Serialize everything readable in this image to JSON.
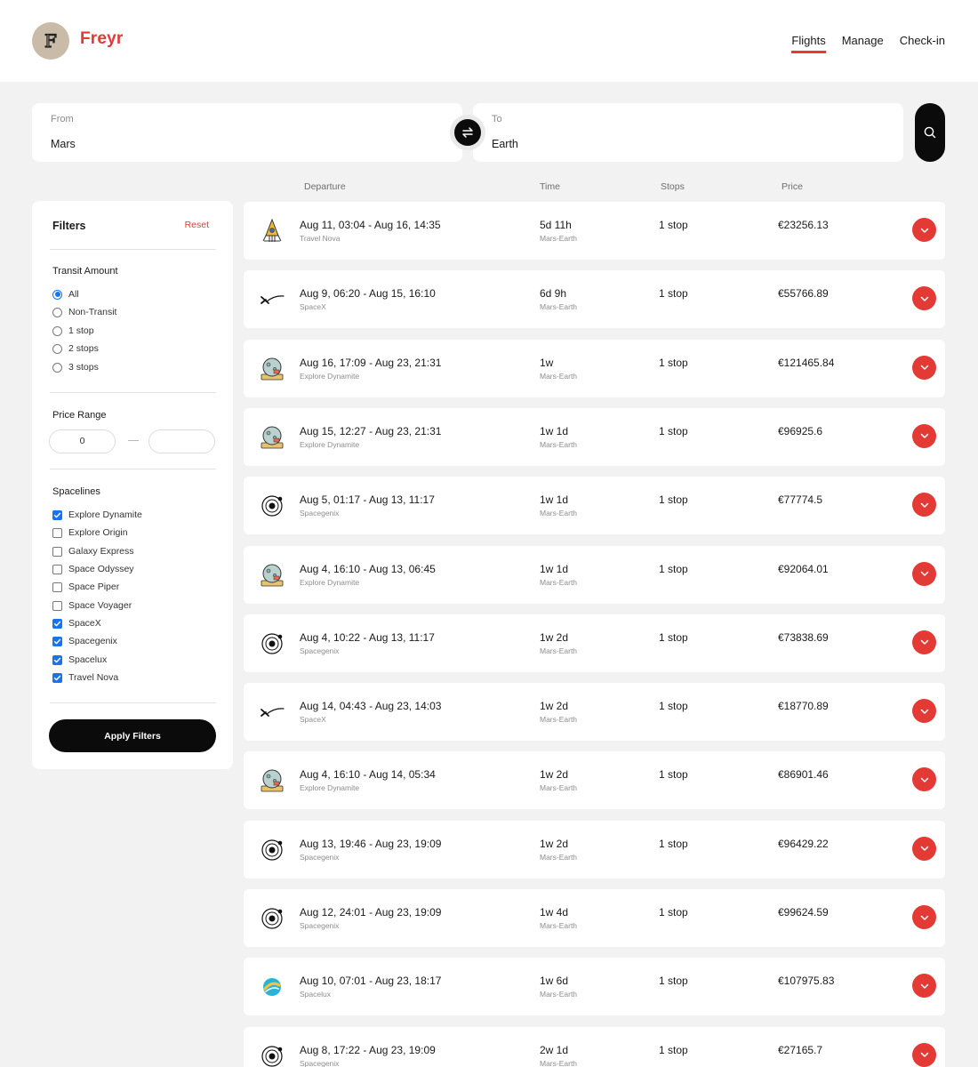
{
  "header": {
    "logo_letter": "F",
    "brand": "Freyr",
    "nav": [
      {
        "label": "Flights",
        "active": true
      },
      {
        "label": "Manage",
        "active": false
      },
      {
        "label": "Check-in",
        "active": false
      }
    ]
  },
  "search": {
    "from_label": "From",
    "from_value": "Mars",
    "to_label": "To",
    "to_value": "Earth",
    "swap_icon": "swap-arrows-icon",
    "search_icon": "search-icon"
  },
  "columns": {
    "departure": "Departure",
    "time": "Time",
    "stops": "Stops",
    "price": "Price"
  },
  "filters": {
    "title": "Filters",
    "reset": "Reset",
    "transit_title": "Transit Amount",
    "transit_options": [
      {
        "label": "All",
        "selected": true
      },
      {
        "label": "Non-Transit",
        "selected": false
      },
      {
        "label": "1 stop",
        "selected": false
      },
      {
        "label": "2 stops",
        "selected": false
      },
      {
        "label": "3 stops",
        "selected": false
      }
    ],
    "price_title": "Price Range",
    "price_min": "0",
    "price_max": "",
    "spacelines_title": "Spacelines",
    "spacelines": [
      {
        "label": "Explore Dynamite",
        "checked": true
      },
      {
        "label": "Explore Origin",
        "checked": false
      },
      {
        "label": "Galaxy Express",
        "checked": false
      },
      {
        "label": "Space Odyssey",
        "checked": false
      },
      {
        "label": "Space Piper",
        "checked": false
      },
      {
        "label": "Space Voyager",
        "checked": false
      },
      {
        "label": "SpaceX",
        "checked": true
      },
      {
        "label": "Spacegenix",
        "checked": true
      },
      {
        "label": "Spacelux",
        "checked": true
      },
      {
        "label": "Travel Nova",
        "checked": true
      }
    ],
    "apply": "Apply Filters"
  },
  "flights": [
    {
      "departure": "Aug 11, 03:04 - Aug 16, 14:35",
      "airline": "Travel Nova",
      "logo": "rocket-logo",
      "time": "5d 11h",
      "route": "Mars-Earth",
      "stops": "1 stop",
      "price": "€23256.13"
    },
    {
      "departure": "Aug 9, 06:20 - Aug 15, 16:10",
      "airline": "SpaceX",
      "logo": "spacex-logo",
      "time": "6d 9h",
      "route": "Mars-Earth",
      "stops": "1 stop",
      "price": "€55766.89"
    },
    {
      "departure": "Aug 16, 17:09 - Aug 23, 21:31",
      "airline": "Explore Dynamite",
      "logo": "moon-logo",
      "time": "1w",
      "route": "Mars-Earth",
      "stops": "1 stop",
      "price": "€121465.84"
    },
    {
      "departure": "Aug 15, 12:27 - Aug 23, 21:31",
      "airline": "Explore Dynamite",
      "logo": "moon-logo",
      "time": "1w 1d",
      "route": "Mars-Earth",
      "stops": "1 stop",
      "price": "€96925.6"
    },
    {
      "departure": "Aug 5, 01:17 - Aug 13, 11:17",
      "airline": "Spacegenix",
      "logo": "orbit-logo",
      "time": "1w 1d",
      "route": "Mars-Earth",
      "stops": "1 stop",
      "price": "€77774.5"
    },
    {
      "departure": "Aug 4, 16:10 - Aug 13, 06:45",
      "airline": "Explore Dynamite",
      "logo": "moon-logo",
      "time": "1w 1d",
      "route": "Mars-Earth",
      "stops": "1 stop",
      "price": "€92064.01"
    },
    {
      "departure": "Aug 4, 10:22 - Aug 13, 11:17",
      "airline": "Spacegenix",
      "logo": "orbit-logo",
      "time": "1w 2d",
      "route": "Mars-Earth",
      "stops": "1 stop",
      "price": "€73838.69"
    },
    {
      "departure": "Aug 14, 04:43 - Aug 23, 14:03",
      "airline": "SpaceX",
      "logo": "spacex-logo",
      "time": "1w 2d",
      "route": "Mars-Earth",
      "stops": "1 stop",
      "price": "€18770.89"
    },
    {
      "departure": "Aug 4, 16:10 - Aug 14, 05:34",
      "airline": "Explore Dynamite",
      "logo": "moon-logo",
      "time": "1w 2d",
      "route": "Mars-Earth",
      "stops": "1 stop",
      "price": "€86901.46"
    },
    {
      "departure": "Aug 13, 19:46 - Aug 23, 19:09",
      "airline": "Spacegenix",
      "logo": "orbit-logo",
      "time": "1w 2d",
      "route": "Mars-Earth",
      "stops": "1 stop",
      "price": "€96429.22"
    },
    {
      "departure": "Aug 12, 24:01 - Aug 23, 19:09",
      "airline": "Spacegenix",
      "logo": "orbit-logo",
      "time": "1w 4d",
      "route": "Mars-Earth",
      "stops": "1 stop",
      "price": "€99624.59"
    },
    {
      "departure": "Aug 10, 07:01 - Aug 23, 18:17",
      "airline": "Spacelux",
      "logo": "planet-logo",
      "time": "1w 6d",
      "route": "Mars-Earth",
      "stops": "1 stop",
      "price": "€107975.83"
    },
    {
      "departure": "Aug 8, 17:22 - Aug 23, 19:09",
      "airline": "Spacegenix",
      "logo": "orbit-logo",
      "time": "2w 1d",
      "route": "Mars-Earth",
      "stops": "1 stop",
      "price": "€27165.7"
    }
  ],
  "colors": {
    "accent": "#e43a35",
    "dark": "#0b0b0b",
    "background": "#f2f2f2",
    "checkbox": "#1a73e8"
  }
}
